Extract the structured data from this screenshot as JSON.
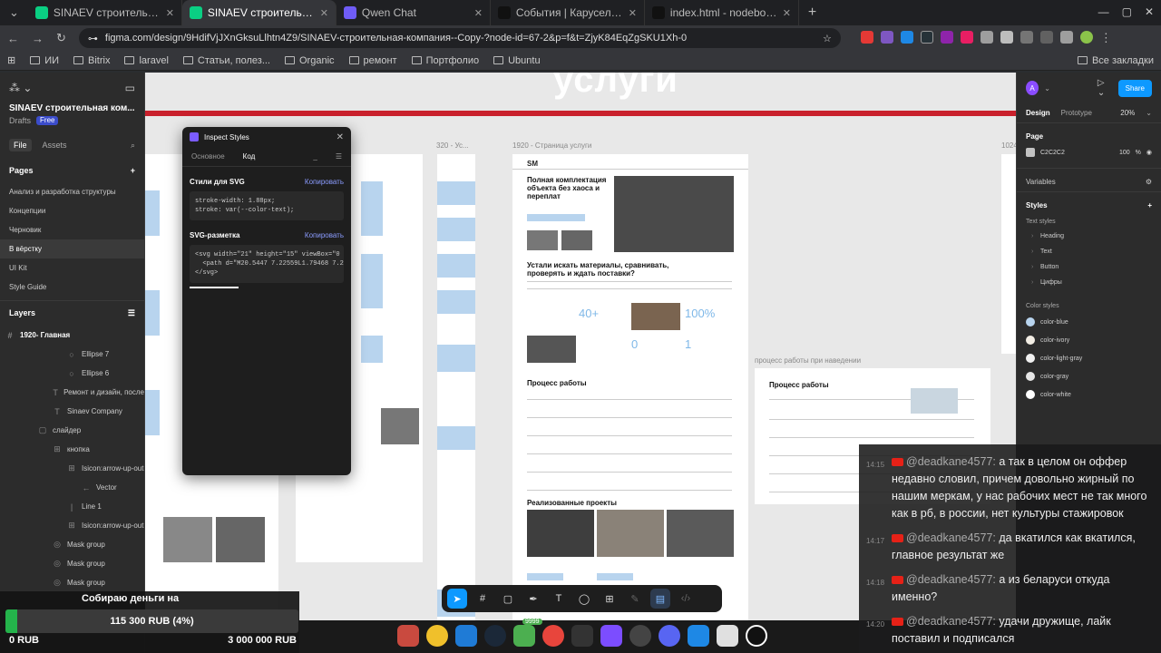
{
  "browser": {
    "tabs": [
      {
        "title": "SINAEV строительная ко",
        "active": false,
        "color": "#0acf83"
      },
      {
        "title": "SINAEV строительная ко",
        "active": true,
        "color": "#0acf83"
      },
      {
        "title": "Qwen Chat",
        "active": false,
        "color": "#6f5cf6"
      },
      {
        "title": "События | Карусель Эм",
        "active": false,
        "color": "#111111"
      },
      {
        "title": "index.html - nodebox - C",
        "active": false,
        "color": "#111111"
      }
    ],
    "url": "figma.com/design/9HdifVjJXnGksuLlhtn4Z9/SINAEV-строительная-компания--Copy-?node-id=67-2&p=f&t=ZjyK84EqZgSKU1Xh-0",
    "bookmarks": [
      "ИИ",
      "Bitrix",
      "laravel",
      "Статьи, полез...",
      "Organic",
      "ремонт",
      "Портфолио",
      "Ubuntu"
    ],
    "all_bookmarks": "Все закладки"
  },
  "figma": {
    "project_name": "SINAEV строительная ком...",
    "drafts": "Drafts",
    "plan": "Free",
    "tab_file": "File",
    "tab_assets": "Assets",
    "pages_title": "Pages",
    "pages": [
      "Анализ и разработка структуры",
      "Концепции",
      "Черновик",
      "В вёрстку",
      "UI Kit",
      "Style Guide"
    ],
    "selected_page": 3,
    "layers_title": "Layers",
    "layers": [
      {
        "name": "1920- Главная",
        "icon": "#",
        "indent": 6
      },
      {
        "name": "Ellipse 7",
        "icon": "○",
        "indent": 74
      },
      {
        "name": "Ellipse 6",
        "icon": "○",
        "indent": 74
      },
      {
        "name": "Ремонт и дизайн, после",
        "icon": "T",
        "indent": 58
      },
      {
        "name": "Sinaev Company",
        "icon": "T",
        "indent": 58
      },
      {
        "name": "слайдер",
        "icon": "▢",
        "indent": 42
      },
      {
        "name": "кнопка",
        "icon": "⊞",
        "indent": 58
      },
      {
        "name": "Isicon:arrow-up-out",
        "icon": "⊞",
        "indent": 74
      },
      {
        "name": "Vector",
        "icon": "←",
        "indent": 90
      },
      {
        "name": "Line 1",
        "icon": "|",
        "indent": 74
      },
      {
        "name": "Isicon:arrow-up-out",
        "icon": "⊞",
        "indent": 74
      },
      {
        "name": "Mask group",
        "icon": "◎",
        "indent": 58
      },
      {
        "name": "Mask group",
        "icon": "◎",
        "indent": 58
      },
      {
        "name": "Mask group",
        "icon": "◎",
        "indent": 58
      }
    ],
    "canvas": {
      "big_title": "услуги",
      "label_320": "320 - Ус...",
      "label_1920": "1920 - Страница услуги",
      "label_1024": "1024",
      "label_process_hover": "процесс работы при наведении",
      "hero_title": "Полная комплектация объекта без хаоса и переплат",
      "section2_title": "Устали искать материалы, сравнивать, проверять и ждать поставки?",
      "stat1": "40+",
      "stat2": "100%",
      "stat3": "0",
      "stat4": "1",
      "process_title": "Процесс работы",
      "projects_title": "Реализованные проекты",
      "hover_process_title": "Процесс работы"
    },
    "inspect": {
      "title": "Inspect Styles",
      "tab_basic": "Основное",
      "tab_code": "Код",
      "svg_styles_title": "Стили для SVG",
      "copy": "Копировать",
      "css_code": "stroke-width: 1.88px;\nstroke: var(--color-text);",
      "svg_title": "SVG-разметка",
      "copy2": "Копировать",
      "svg_code": "<svg width=\"21\" height=\"15\" viewBox=\"0 0\n  <path d=\"M20.5447 7.22559L1.79468 7.2255\n</svg>"
    },
    "right": {
      "avatar": "A",
      "share": "Share",
      "tab_design": "Design",
      "tab_prototype": "Prototype",
      "zoom": "20%",
      "page_title": "Page",
      "page_color": "C2C2C2",
      "page_opacity": "100",
      "percent": "%",
      "variables": "Variables",
      "styles": "Styles",
      "text_styles": "Text styles",
      "text_style_items": [
        "Heading",
        "Text",
        "Button",
        "Цифры"
      ],
      "color_styles": "Color styles",
      "color_items": [
        {
          "name": "color-blue",
          "color": "#b8d4ee"
        },
        {
          "name": "color-ivory",
          "color": "#f2ede4"
        },
        {
          "name": "color-light-gray",
          "color": "#f0f0f0"
        },
        {
          "name": "color-gray",
          "color": "#e6e6e6"
        },
        {
          "name": "color-white",
          "color": "#ffffff"
        }
      ]
    }
  },
  "chat": [
    {
      "time": "14:15",
      "user": "@deadkane4577:",
      "text": "а так в целом он оффер недавно словил, причем довольно жирный по нашим меркам, у нас рабочих мест не так много как в рб, в россии, нет культуры стажировок"
    },
    {
      "time": "14:17",
      "user": "@deadkane4577:",
      "text": "да вкатился как вкатился, главное результат же"
    },
    {
      "time": "14:18",
      "user": "@deadkane4577:",
      "text": "а из беларуси откуда именно?"
    },
    {
      "time": "14:20",
      "user": "@deadkane4577:",
      "text": "удачи дружище, лайк поставил и подписался"
    }
  ],
  "donation": {
    "title": "Собираю деньги на",
    "value": "115 300 RUB (4%)",
    "progress_fraction": 0.04,
    "min": "0 RUB",
    "max": "3 000 000 RUB"
  },
  "dock": {
    "badge": "9999"
  }
}
